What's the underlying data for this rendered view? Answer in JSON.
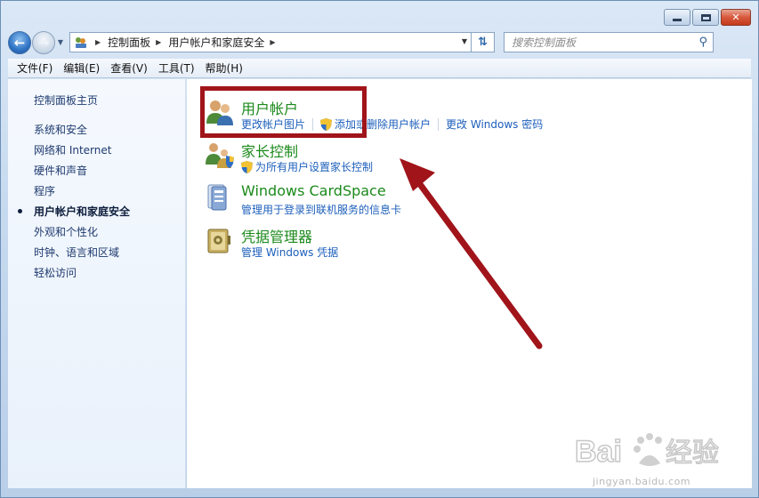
{
  "address": {
    "breadcrumbs": [
      "控制面板",
      "用户帐户和家庭安全"
    ]
  },
  "search": {
    "placeholder": "搜索控制面板"
  },
  "menu": [
    "文件(F)",
    "编辑(E)",
    "查看(V)",
    "工具(T)",
    "帮助(H)"
  ],
  "sidebar": {
    "items": [
      {
        "label": "控制面板主页"
      },
      {
        "label": "系统和安全"
      },
      {
        "label": "网络和 Internet"
      },
      {
        "label": "硬件和声音"
      },
      {
        "label": "程序"
      },
      {
        "label": "用户帐户和家庭安全",
        "active": true
      },
      {
        "label": "外观和个性化"
      },
      {
        "label": "时钟、语言和区域"
      },
      {
        "label": "轻松访问"
      }
    ]
  },
  "categories": [
    {
      "title": "用户帐户",
      "icon": "users-icon",
      "links": [
        "更改帐户图片",
        "添加或删除用户帐户",
        "更改 Windows 密码"
      ]
    },
    {
      "title": "家长控制",
      "icon": "parental-control-icon",
      "links": [
        "为所有用户设置家长控制"
      ]
    },
    {
      "title": "Windows CardSpace",
      "icon": "cardspace-icon",
      "links": [
        "管理用于登录到联机服务的信息卡"
      ]
    },
    {
      "title": "凭据管理器",
      "icon": "credential-manager-icon",
      "links": [
        "管理 Windows 凭据"
      ]
    }
  ],
  "watermark": {
    "url": "jingyan.baidu.com"
  },
  "colors": {
    "highlight": "#a0141a",
    "category_title": "#1b8a1b",
    "link": "#1d5fbb",
    "arrow": "#a0141a"
  }
}
